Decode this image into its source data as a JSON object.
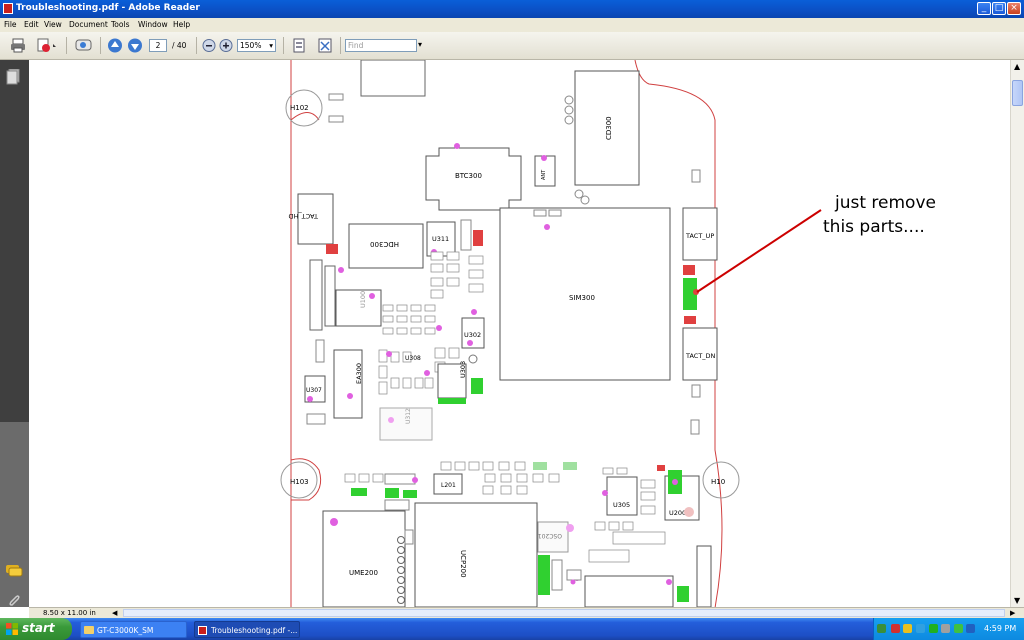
{
  "window": {
    "title": "Troubleshooting.pdf - Adobe Reader",
    "controls": {
      "minimize": "_",
      "maximize": "□",
      "close": "×"
    }
  },
  "menu": [
    "File",
    "Edit",
    "View",
    "Document",
    "Tools",
    "Window",
    "Help"
  ],
  "toolbar": {
    "page_current": "2",
    "page_total": "/ 40",
    "zoom": "150%",
    "find_placeholder": "Find"
  },
  "status": {
    "page_size": "8.50 x 11.00 in"
  },
  "annotation": {
    "line1": "just remove",
    "line2": "this parts...."
  },
  "schematic_labels": {
    "h102": "H102",
    "h103": "H103",
    "h104": "H10",
    "btc300": "BTC300",
    "cd300": "CD300",
    "tact_hd": "TACT_HD",
    "hdc300": "HDC300",
    "u311": "U311",
    "sim300": "SIM300",
    "tact_up": "TACT_UP",
    "tact_dn": "TACT_DN",
    "u100": "U100",
    "u302": "U302",
    "u308": "U308",
    "u303": "U303",
    "ea300": "EA300",
    "u307": "U307",
    "u312": "U312",
    "u305": "U305",
    "u200": "U200",
    "ume200": "UME200",
    "ucp200": "UCP200",
    "osc201": "OSC201",
    "ant": "ANT",
    "l201": "L201"
  },
  "taskbar": {
    "start": "start",
    "items": [
      "GT-C3000K_SM",
      "Troubleshooting.pdf -..."
    ],
    "clock": "4:59 PM"
  },
  "colors": {
    "titlebar": "#0b4fc4",
    "pcb_outline": "#d04040",
    "pad_pink": "#e060e0",
    "pad_green": "#30d030",
    "pad_red": "#e04040",
    "arrow": "#cc0000"
  }
}
